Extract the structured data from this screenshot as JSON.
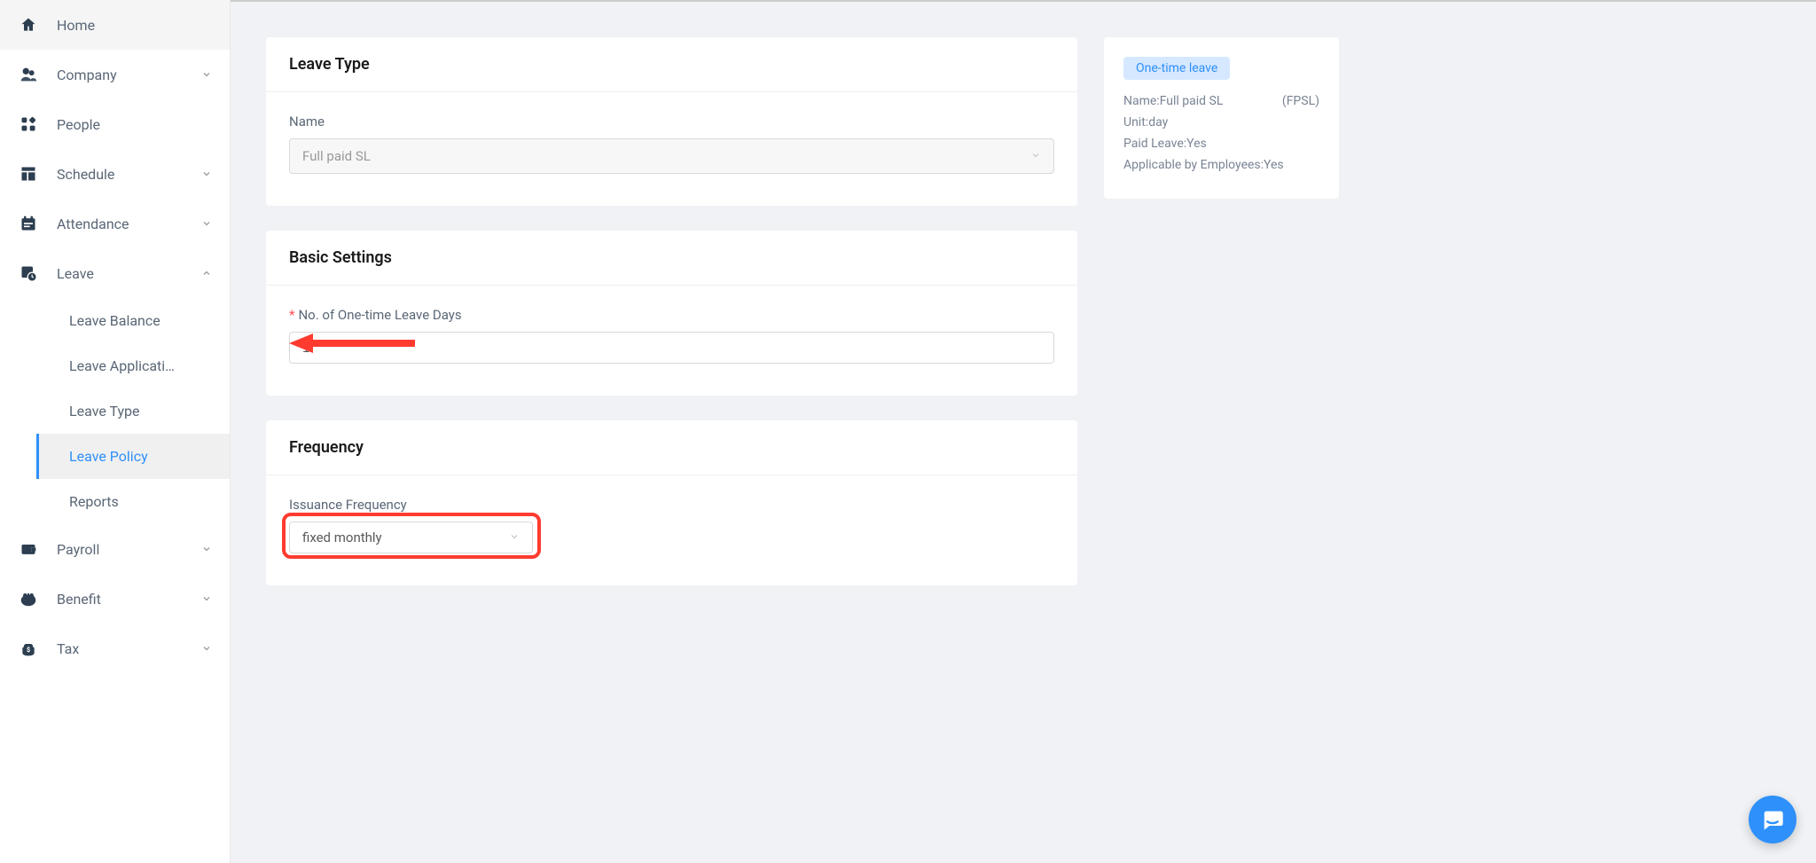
{
  "sidebar": {
    "items": [
      {
        "label": "Home",
        "icon": "home",
        "expandable": false
      },
      {
        "label": "Company",
        "icon": "company",
        "expandable": true,
        "expanded": false
      },
      {
        "label": "People",
        "icon": "people",
        "expandable": false
      },
      {
        "label": "Schedule",
        "icon": "schedule",
        "expandable": true,
        "expanded": false
      },
      {
        "label": "Attendance",
        "icon": "attendance",
        "expandable": true,
        "expanded": false
      },
      {
        "label": "Leave",
        "icon": "leave",
        "expandable": true,
        "expanded": true,
        "children": [
          {
            "label": "Leave Balance"
          },
          {
            "label": "Leave Applicati…"
          },
          {
            "label": "Leave Type"
          },
          {
            "label": "Leave Policy",
            "active": true
          },
          {
            "label": "Reports"
          }
        ]
      },
      {
        "label": "Payroll",
        "icon": "payroll",
        "expandable": true,
        "expanded": false
      },
      {
        "label": "Benefit",
        "icon": "benefit",
        "expandable": true,
        "expanded": false
      },
      {
        "label": "Tax",
        "icon": "tax",
        "expandable": true,
        "expanded": false
      }
    ]
  },
  "cards": {
    "leaveType": {
      "title": "Leave Type",
      "nameLabel": "Name",
      "nameValue": "Full paid SL"
    },
    "basicSettings": {
      "title": "Basic Settings",
      "daysLabel": "No. of One-time Leave Days",
      "daysValue": "1"
    },
    "frequency": {
      "title": "Frequency",
      "issuanceLabel": "Issuance Frequency",
      "issuanceValue": "fixed monthly"
    }
  },
  "infoPanel": {
    "badge": "One-time leave",
    "nameLabel": "Name: ",
    "nameValue": "Full paid SL",
    "code": "(FPSL)",
    "unitLabel": "Unit: ",
    "unitValue": "day",
    "paidLabel": "Paid Leave: ",
    "paidValue": "Yes",
    "applicableLabel": "Applicable by Employees: ",
    "applicableValue": "Yes"
  }
}
